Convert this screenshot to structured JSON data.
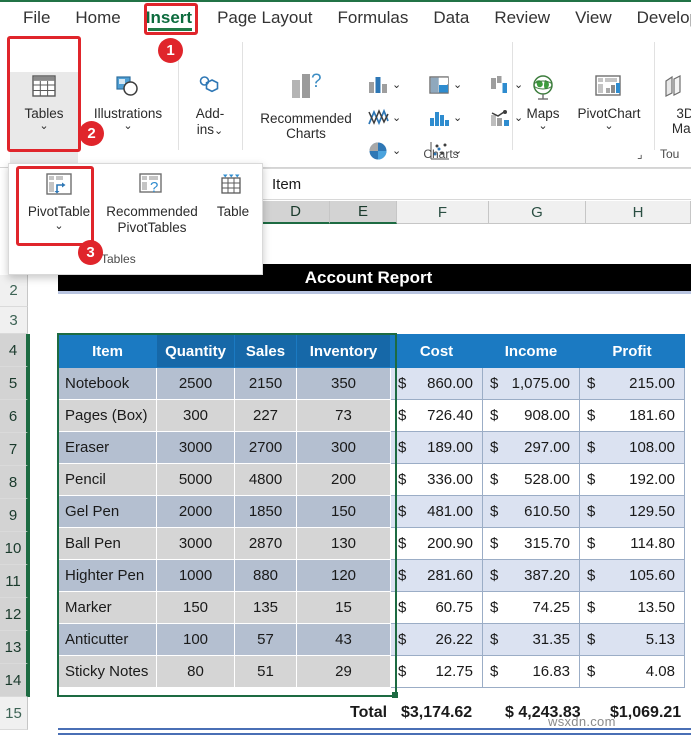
{
  "ribbon": {
    "tabs": [
      {
        "label": "File",
        "active": false
      },
      {
        "label": "Home",
        "active": false
      },
      {
        "label": "Insert",
        "active": true
      },
      {
        "label": "Page Layout",
        "active": false
      },
      {
        "label": "Formulas",
        "active": false
      },
      {
        "label": "Data",
        "active": false
      },
      {
        "label": "Review",
        "active": false
      },
      {
        "label": "View",
        "active": false
      },
      {
        "label": "Developer",
        "active": false
      }
    ],
    "buttons": {
      "tables": {
        "label": "Tables",
        "chevron": "⌄",
        "icon": "table-grid-icon"
      },
      "illustrations": {
        "label": "Illustrations",
        "chevron": "⌄",
        "icon": "shapes-icon"
      },
      "addins": {
        "label_line1": "Add-",
        "label_line2": "ins",
        "chevron": "⌄",
        "icon": "addins-hexagon-icon"
      },
      "recommended_charts": {
        "label_line1": "Recommended",
        "label_line2": "Charts",
        "icon": "recommended-charts-icon"
      },
      "maps": {
        "label": "Maps",
        "chevron": "⌄",
        "icon": "globe-icon"
      },
      "pivotchart": {
        "label": "PivotChart",
        "chevron": "⌄",
        "icon": "pivotchart-icon"
      },
      "maps3d": {
        "label_line1": "3D",
        "label_line2": "Map",
        "icon": "3d-map-icon"
      }
    },
    "group_labels": {
      "charts": "Charts",
      "tours": "Tou"
    },
    "chart_icons": [
      "column-chart-icon",
      "hierarchy-chart-icon",
      "waterfall-chart-icon",
      "line-chart-icon",
      "statistic-chart-icon",
      "combo-chart-icon",
      "pie-chart-icon",
      "scatter-chart-icon"
    ],
    "dialog_launcher": "charts-dialog-launcher-icon"
  },
  "annotations": {
    "badge1": "1",
    "badge2": "2",
    "badge3": "3",
    "accent_color": "#e0252b"
  },
  "dropdown": {
    "items": [
      {
        "label": "PivotTable",
        "chevron": "⌄",
        "icon": "pivottable-icon"
      },
      {
        "label_line1": "Recommended",
        "label_line2": "PivotTables",
        "icon": "recommended-pivottables-icon"
      },
      {
        "label": "Table",
        "icon": "table-icon"
      }
    ],
    "group_label": "Tables"
  },
  "formula_bar": {
    "value": "Item"
  },
  "grid": {
    "column_headers": [
      {
        "label": "D",
        "selected": true
      },
      {
        "label": "E",
        "selected": true
      },
      {
        "label": "F",
        "selected": false
      },
      {
        "label": "G",
        "selected": false
      },
      {
        "label": "H",
        "selected": false
      }
    ],
    "row_headers": [
      {
        "label": "2",
        "selected": false
      },
      {
        "label": "3",
        "selected": false
      },
      {
        "label": "4",
        "selected": true
      },
      {
        "label": "5",
        "selected": true
      },
      {
        "label": "6",
        "selected": true
      },
      {
        "label": "7",
        "selected": true
      },
      {
        "label": "8",
        "selected": true
      },
      {
        "label": "9",
        "selected": true
      },
      {
        "label": "10",
        "selected": true
      },
      {
        "label": "11",
        "selected": true
      },
      {
        "label": "12",
        "selected": true
      },
      {
        "label": "13",
        "selected": true
      },
      {
        "label": "14",
        "selected": true
      },
      {
        "label": "15",
        "selected": false
      }
    ]
  },
  "report": {
    "title": "Account Report",
    "headers": [
      "Item",
      "Quantity",
      "Sales",
      "Inventory",
      "Cost",
      "Income",
      "Profit"
    ],
    "rows": [
      {
        "item": "Notebook",
        "quantity": "2500",
        "sales": "2150",
        "inventory": "350",
        "cost": "860.00",
        "income": "1,075.00",
        "profit": "215.00"
      },
      {
        "item": "Pages (Box)",
        "quantity": "300",
        "sales": "227",
        "inventory": "73",
        "cost": "726.40",
        "income": "908.00",
        "profit": "181.60"
      },
      {
        "item": "Eraser",
        "quantity": "3000",
        "sales": "2700",
        "inventory": "300",
        "cost": "189.00",
        "income": "297.00",
        "profit": "108.00"
      },
      {
        "item": "Pencil",
        "quantity": "5000",
        "sales": "4800",
        "inventory": "200",
        "cost": "336.00",
        "income": "528.00",
        "profit": "192.00"
      },
      {
        "item": "Gel Pen",
        "quantity": "2000",
        "sales": "1850",
        "inventory": "150",
        "cost": "481.00",
        "income": "610.50",
        "profit": "129.50"
      },
      {
        "item": "Ball Pen",
        "quantity": "3000",
        "sales": "2870",
        "inventory": "130",
        "cost": "200.90",
        "income": "315.70",
        "profit": "114.80"
      },
      {
        "item": "Highter Pen",
        "quantity": "1000",
        "sales": "880",
        "inventory": "120",
        "cost": "281.60",
        "income": "387.20",
        "profit": "105.60"
      },
      {
        "item": "Marker",
        "quantity": "150",
        "sales": "135",
        "inventory": "15",
        "cost": "60.75",
        "income": "74.25",
        "profit": "13.50"
      },
      {
        "item": "Anticutter",
        "quantity": "100",
        "sales": "57",
        "inventory": "43",
        "cost": "26.22",
        "income": "31.35",
        "profit": "5.13"
      },
      {
        "item": "Sticky Notes",
        "quantity": "80",
        "sales": "51",
        "inventory": "29",
        "cost": "12.75",
        "income": "16.83",
        "profit": "4.08"
      }
    ],
    "currency_symbol": "$",
    "total": {
      "label": "Total",
      "cost": "$3,174.62",
      "income": "$ 4,243.83",
      "profit": "$1,069.21"
    },
    "header_color": "#1b7ac2",
    "title_bg": "#000000"
  },
  "watermark": "wsxdn.com"
}
